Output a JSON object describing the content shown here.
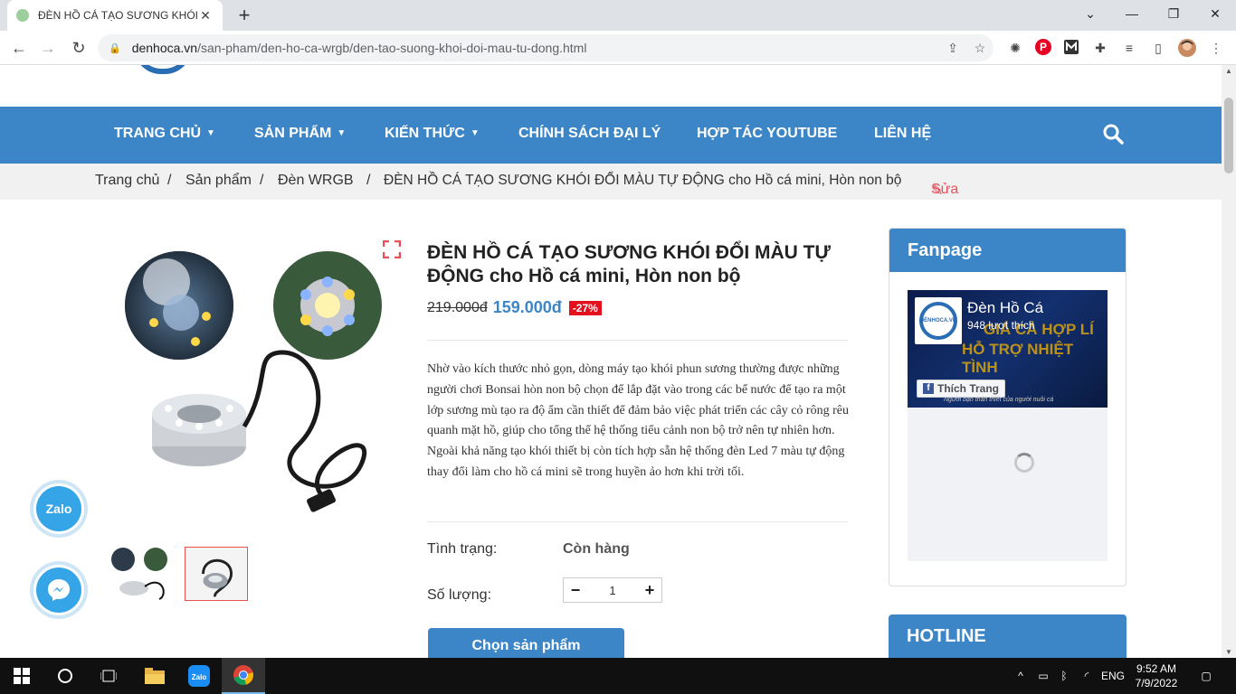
{
  "browser": {
    "tab_title": "ĐÈN HỒ CÁ TẠO SƯƠNG KHÓI Đ",
    "tab_close": "✕",
    "new_tab": "+",
    "url_host": "denhoca.vn",
    "url_path": "/san-pham/den-ho-ca-wrgb/den-tao-suong-khoi-doi-mau-tu-dong.html",
    "controls": {
      "minimize": "—",
      "maximize": "❐",
      "close": "✕",
      "tab_list": "⌄"
    }
  },
  "nav": {
    "items": [
      {
        "label": "TRANG CHỦ",
        "dropdown": true
      },
      {
        "label": "SẢN PHẨM",
        "dropdown": true
      },
      {
        "label": "KIẾN THỨC",
        "dropdown": true
      },
      {
        "label": "CHÍNH SÁCH ĐẠI LÝ",
        "dropdown": false
      },
      {
        "label": "HỢP TÁC YOUTUBE",
        "dropdown": false
      },
      {
        "label": "LIÊN HỆ",
        "dropdown": false
      }
    ],
    "chevron": "▼"
  },
  "breadcrumb": {
    "home": "Trang chủ",
    "products": "Sản phẩm",
    "category": "Đèn WRGB",
    "current": "ĐÈN HỒ CÁ TẠO SƯƠNG KHÓI ĐỔI MÀU TỰ ĐỘNG cho Hồ cá mini, Hòn non bộ",
    "separator": "/",
    "edit": "Sửa"
  },
  "product": {
    "title": "ĐÈN HỒ CÁ TẠO SƯƠNG KHÓI ĐỔI MÀU TỰ ĐỘNG cho Hồ cá mini, Hòn non bộ",
    "old_price": "219.000đ",
    "new_price": "159.000đ",
    "discount": "-27%",
    "description": "Nhờ vào kích thước nhỏ gọn, dòng máy tạo khói phun sương thường được những người chơi Bonsai hòn non bộ chọn để lắp đặt vào trong các bể nước để tạo ra một lớp sương mù tạo ra độ ẩm cần thiết để đảm bảo việc phát triển các cây cỏ rông rêu quanh mặt hồ, giúp cho tổng thể hệ thống tiểu cảnh non bộ trở nên tự nhiên hơn. Ngoài khả năng tạo khói thiết bị còn tích hợp sẵn hệ thống đèn Led 7 màu tự động thay đổi làm cho hồ cá mini sẽ trong huyền ảo hơn khi trời tối.",
    "status_label": "Tình trạng:",
    "status_value": "Còn hàng",
    "qty_label": "Số lượng:",
    "qty_minus": "−",
    "qty_plus": "+",
    "qty_value": "1",
    "buy_button": "Chọn sản phẩm"
  },
  "sidebar": {
    "fanpage_title": "Fanpage",
    "fb_page_name": "Đèn Hồ Cá",
    "fb_likes": "948 lượt thích",
    "fb_like_button": "Thích Trang",
    "fb_cover_slogan_1": "GIÁ CẢ HỢP LÍ",
    "fb_cover_slogan_2": "HỖ TRỢ NHIỆT TÌNH",
    "fb_cover_tagline": "Người bạn thân thiết của người nuôi cá",
    "fb_avatar_text": "ĐÈNHOCA.VN",
    "hotline_title": "HOTLINE"
  },
  "floating": {
    "zalo": "Zalo"
  },
  "taskbar": {
    "language": "ENG",
    "time": "9:52 AM",
    "date": "7/9/2022"
  },
  "colors": {
    "brand_blue": "#3c86c7",
    "discount_red": "#e5101d",
    "edit_red": "#e8505b"
  }
}
